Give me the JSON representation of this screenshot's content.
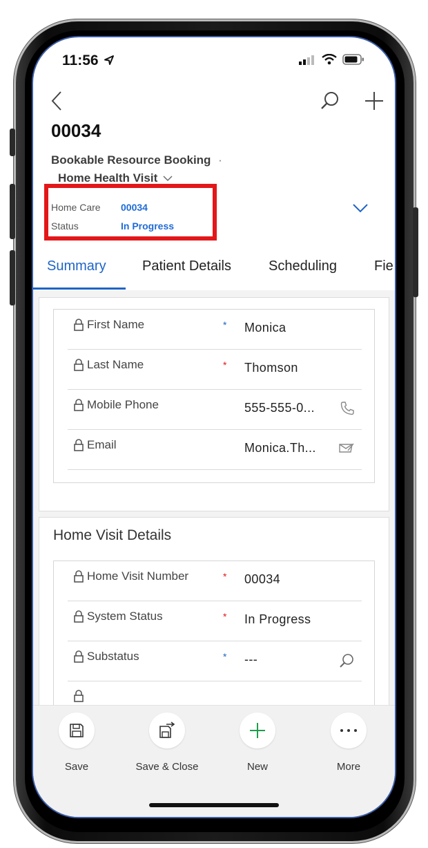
{
  "status_bar": {
    "time": "11:56"
  },
  "record": {
    "id": "00034",
    "entity": "Bookable Resource Booking",
    "separator": "·",
    "form": "Home Health Visit"
  },
  "header_fields": [
    {
      "label": "Home Care",
      "value": "00034"
    },
    {
      "label": "Status",
      "value": "In Progress"
    }
  ],
  "tabs": [
    {
      "label": "Summary",
      "active": true
    },
    {
      "label": "Patient Details",
      "active": false
    },
    {
      "label": "Scheduling",
      "active": false
    },
    {
      "label": "Fie",
      "active": false
    }
  ],
  "contact_section": {
    "fields": [
      {
        "label": "First Name",
        "required": "*",
        "required_color": "#1f64c6",
        "value": "Monica",
        "icon": ""
      },
      {
        "label": "Last Name",
        "required": "*",
        "required_color": "#e3171a",
        "value": "Thomson",
        "icon": ""
      },
      {
        "label": "Mobile Phone",
        "required": "",
        "required_color": "",
        "value": "555-555-0...",
        "icon": "phone-icon"
      },
      {
        "label": "Email",
        "required": "",
        "required_color": "",
        "value": "Monica.Th...",
        "icon": "email-icon"
      }
    ]
  },
  "visit_section": {
    "title": "Home Visit Details",
    "fields": [
      {
        "label": "Home Visit Number",
        "required": "*",
        "required_color": "#e3171a",
        "value": "00034",
        "icon": ""
      },
      {
        "label": "System Status",
        "required": "*",
        "required_color": "#e3171a",
        "value": "In Progress",
        "icon": ""
      },
      {
        "label": "Substatus",
        "required": "*",
        "required_color": "#1f64c6",
        "value": "---",
        "icon": "search-icon"
      }
    ]
  },
  "command_bar": [
    {
      "label": "Save",
      "icon": "save-icon"
    },
    {
      "label": "Save & Close",
      "icon": "save-close-icon"
    },
    {
      "label": "New",
      "icon": "plus-icon"
    },
    {
      "label": "More",
      "icon": "more-icon"
    }
  ],
  "colors": {
    "accent": "#1f64c6",
    "highlight": "#e3171a",
    "required_red": "#e3171a"
  }
}
